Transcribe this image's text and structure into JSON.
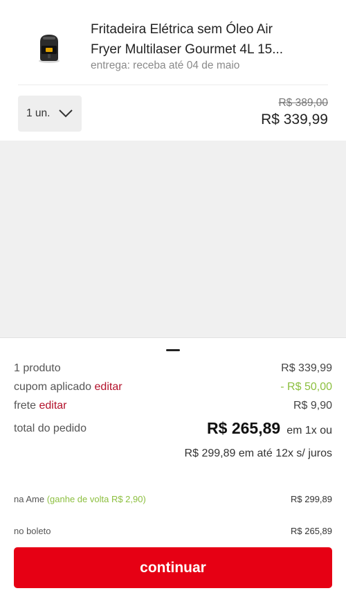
{
  "product": {
    "title_line1": "Fritadeira Elétrica sem Óleo Air",
    "title_line2": "Fryer Multilaser Gourmet 4L 15...",
    "delivery": "entrega: receba até 04 de maio",
    "quantity_label": "1 un.",
    "old_price": "R$ 389,00",
    "price": "R$ 339,99"
  },
  "summary": {
    "products_label": "1 produto",
    "products_value": "R$ 339,99",
    "coupon_label": "cupom aplicado",
    "coupon_edit": "editar",
    "coupon_value": "- R$ 50,00",
    "shipping_label": "frete",
    "shipping_edit": "editar",
    "shipping_value": "R$ 9,90",
    "total_label": "total do pedido",
    "total_value": "R$ 265,89",
    "total_suffix": "em 1x ou",
    "installments": "R$ 299,89 em até 12x s/ juros"
  },
  "payment": {
    "ame_label": "na Ame",
    "ame_cashback": "(ganhe de volta R$ 2,90)",
    "ame_value": "R$ 299,89",
    "boleto_label": "no boleto",
    "boleto_value": "R$ 265,89"
  },
  "actions": {
    "continue_label": "continuar"
  },
  "colors": {
    "brand_red": "#e60014",
    "link_red": "#b3102a",
    "discount_green": "#8cbf3f"
  },
  "icons": {
    "quantity_dropdown": "chevron-down-icon",
    "product_image": "air-fryer-image"
  }
}
